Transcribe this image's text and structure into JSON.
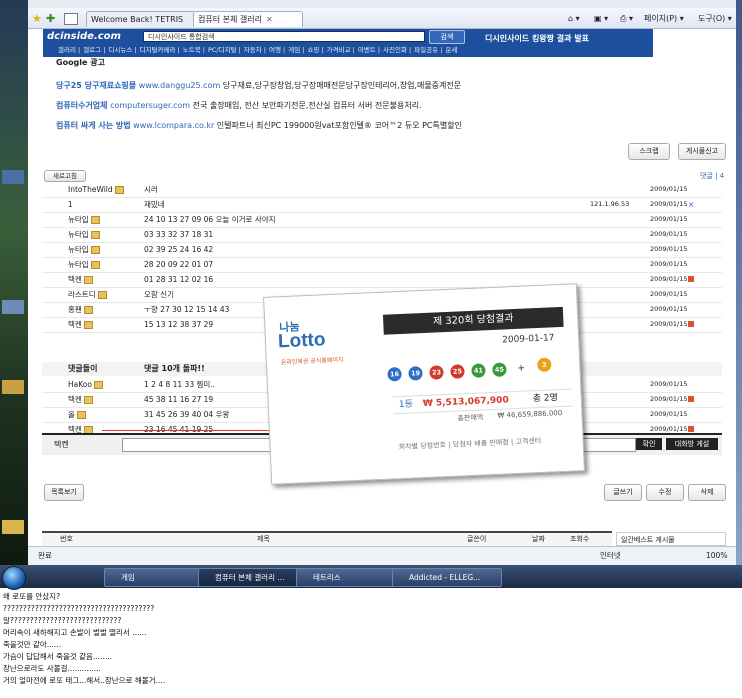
{
  "browser": {
    "tabs": [
      "Welcome Back! TETRIS",
      "컴퓨터 본체 갤러리"
    ],
    "toolbar": {
      "page_label": "페이지(P) ▾",
      "tools_label": "도구(O) ▾"
    }
  },
  "site": {
    "logo": "dcinside.com",
    "search_placeholder": "디시인사이드 통합검색",
    "search_button": "검색",
    "promo": "디시인사이드 킹왕짱 결과 발표",
    "nav": [
      "갤러리",
      "갤로그",
      "디시뉴스",
      "디지털카메라",
      "노트북",
      "PC/디지털",
      "자동차",
      "여행",
      "게임",
      "쇼핑",
      "가격비교",
      "이벤트",
      "사진인화",
      "파일공유",
      "운세"
    ]
  },
  "ads": {
    "header": "Google 광고",
    "items": [
      {
        "title": "당구25 당구재료쇼핑몰",
        "url": "www.danggu25.com",
        "desc": "당구재료,당구장창업,당구장매매전문당구장인테리어,창업,매물중계전문"
      },
      {
        "title": "컴퓨터수거업체",
        "url": "computersuger.com",
        "desc": "전국 출장매입, 전산 보안파기전문,전산실 컴퓨터 서버 전문불용처리."
      },
      {
        "title": "컴퓨터 싸게 사는 방법",
        "url": "www.lcompara.co.kr",
        "desc": "인텔파트너 최신PC 199000원vat포함인텔® 코어™2 듀오 PC특별할인"
      }
    ]
  },
  "board": {
    "scrap_button": "스크랩",
    "post_button": "게시물신고",
    "refresh_button": "새로고침",
    "comment_count_label": "댓글 | 4",
    "rows": [
      {
        "name": "IntoTheWild",
        "text": "시러",
        "extra": "",
        "date": "2009/01/15",
        "mark": false,
        "icon": true
      },
      {
        "name": "1",
        "text": "재밌네",
        "extra": "121.1.96.53",
        "date": "2009/01/15",
        "mark": "x",
        "icon": false
      },
      {
        "name": "뉴타입",
        "text": "24 10 13 27 09 06 오늘 이거로 사야지",
        "extra": "",
        "date": "2009/01/15",
        "mark": false,
        "icon": true
      },
      {
        "name": "뉴타입",
        "text": "03 33 32 37 18 31",
        "extra": "",
        "date": "2009/01/15",
        "mark": false,
        "icon": true
      },
      {
        "name": "뉴타입",
        "text": "02 39 25 24 16 42",
        "extra": "",
        "date": "2009/01/15",
        "mark": false,
        "icon": true
      },
      {
        "name": "뉴타입",
        "text": "28 20 09 22 01 07",
        "extra": "",
        "date": "2009/01/15",
        "mark": false,
        "icon": true
      },
      {
        "name": "텍켄",
        "text": "01 28 31 12 02 16",
        "extra": "",
        "date": "2009/01/15",
        "mark": true,
        "icon": true
      },
      {
        "name": "라스트디",
        "text": "오함 신기",
        "extra": "",
        "date": "2009/01/15",
        "mark": false,
        "icon": true
      },
      {
        "name": "홍팬",
        "text": "ㅜ향 27 30 12 15 14 43",
        "extra": "",
        "date": "2009/01/15",
        "mark": false,
        "icon": true
      },
      {
        "name": "텍켄",
        "text": "15 13 12 38 37 29",
        "extra": "",
        "date": "2009/01/15",
        "mark": true,
        "icon": true
      }
    ],
    "notice": "댓글돌이",
    "notice_text": "댓글 10개 돌파!!",
    "rows2": [
      {
        "name": "HaKoo",
        "text": "1 2 4 8 11 33 찜미..",
        "date": "2009/01/15",
        "mark": false
      },
      {
        "name": "텍켄",
        "text": "45 38 11 16 27 19",
        "date": "2009/01/15",
        "mark": true
      },
      {
        "name": "올",
        "text": "31 45 26 39 40 04 우왕",
        "date": "2009/01/15",
        "mark": false
      },
      {
        "name": "텍켄",
        "text": "23 16 45 41 19 25",
        "date": "2009/01/15",
        "mark": true
      },
      {
        "name": "텍켄",
        "text": "09 32 33 20 44 23",
        "date": "2009/01/15",
        "mark": true
      }
    ],
    "input_name": "텍켄",
    "confirm_button": "확인",
    "gaming_button": "대화방 게설",
    "list_button": "목록보기",
    "write_button": "글쓰기",
    "edit_button": "수정",
    "delete_button": "삭제",
    "columns": [
      "번호",
      "제목",
      "글쓴이",
      "날짜",
      "조회수"
    ],
    "best_label": "일간베스트 게시물"
  },
  "lotto": {
    "brand_small": "나눔",
    "brand": "Lotto",
    "tagline": "온라인복권 공식홈페이지",
    "round": "제 320회 당첨결과",
    "date": "2009-01-17",
    "balls": [
      "16",
      "19",
      "23",
      "25",
      "41",
      "45"
    ],
    "bonus": "3",
    "rank_label": "1등",
    "amount": "₩ 5,513,067,900",
    "winners": "총 2명",
    "total_label": "총판매액",
    "total": "₩ 46,659,886,000",
    "links": "회차별 당첨번호 | 당첨자 배출 판매점 | 고객센터"
  },
  "statusbar": {
    "done": "완료",
    "zone": "인터넷",
    "zoom": "100%"
  },
  "taskbar": {
    "items": [
      "게임",
      "컴퓨터 본체 갤러리 ...",
      "테트리스",
      "Addicted - ELLEG..."
    ]
  },
  "post_text": [
    "왜 로또를 안샀지?",
    "??????????????????????????????????????",
    "알????????????????????????????",
    "머리속이 새하해지고 손발이 벌벌 떨리서 ......",
    "죽을것만 같아......",
    "가슴이 답답해서 죽을것 같음........",
    "장난으로라도 사볼걸..............",
    "거의 얼마전에 로또 태그...해서..장난으로 해볼거...."
  ]
}
